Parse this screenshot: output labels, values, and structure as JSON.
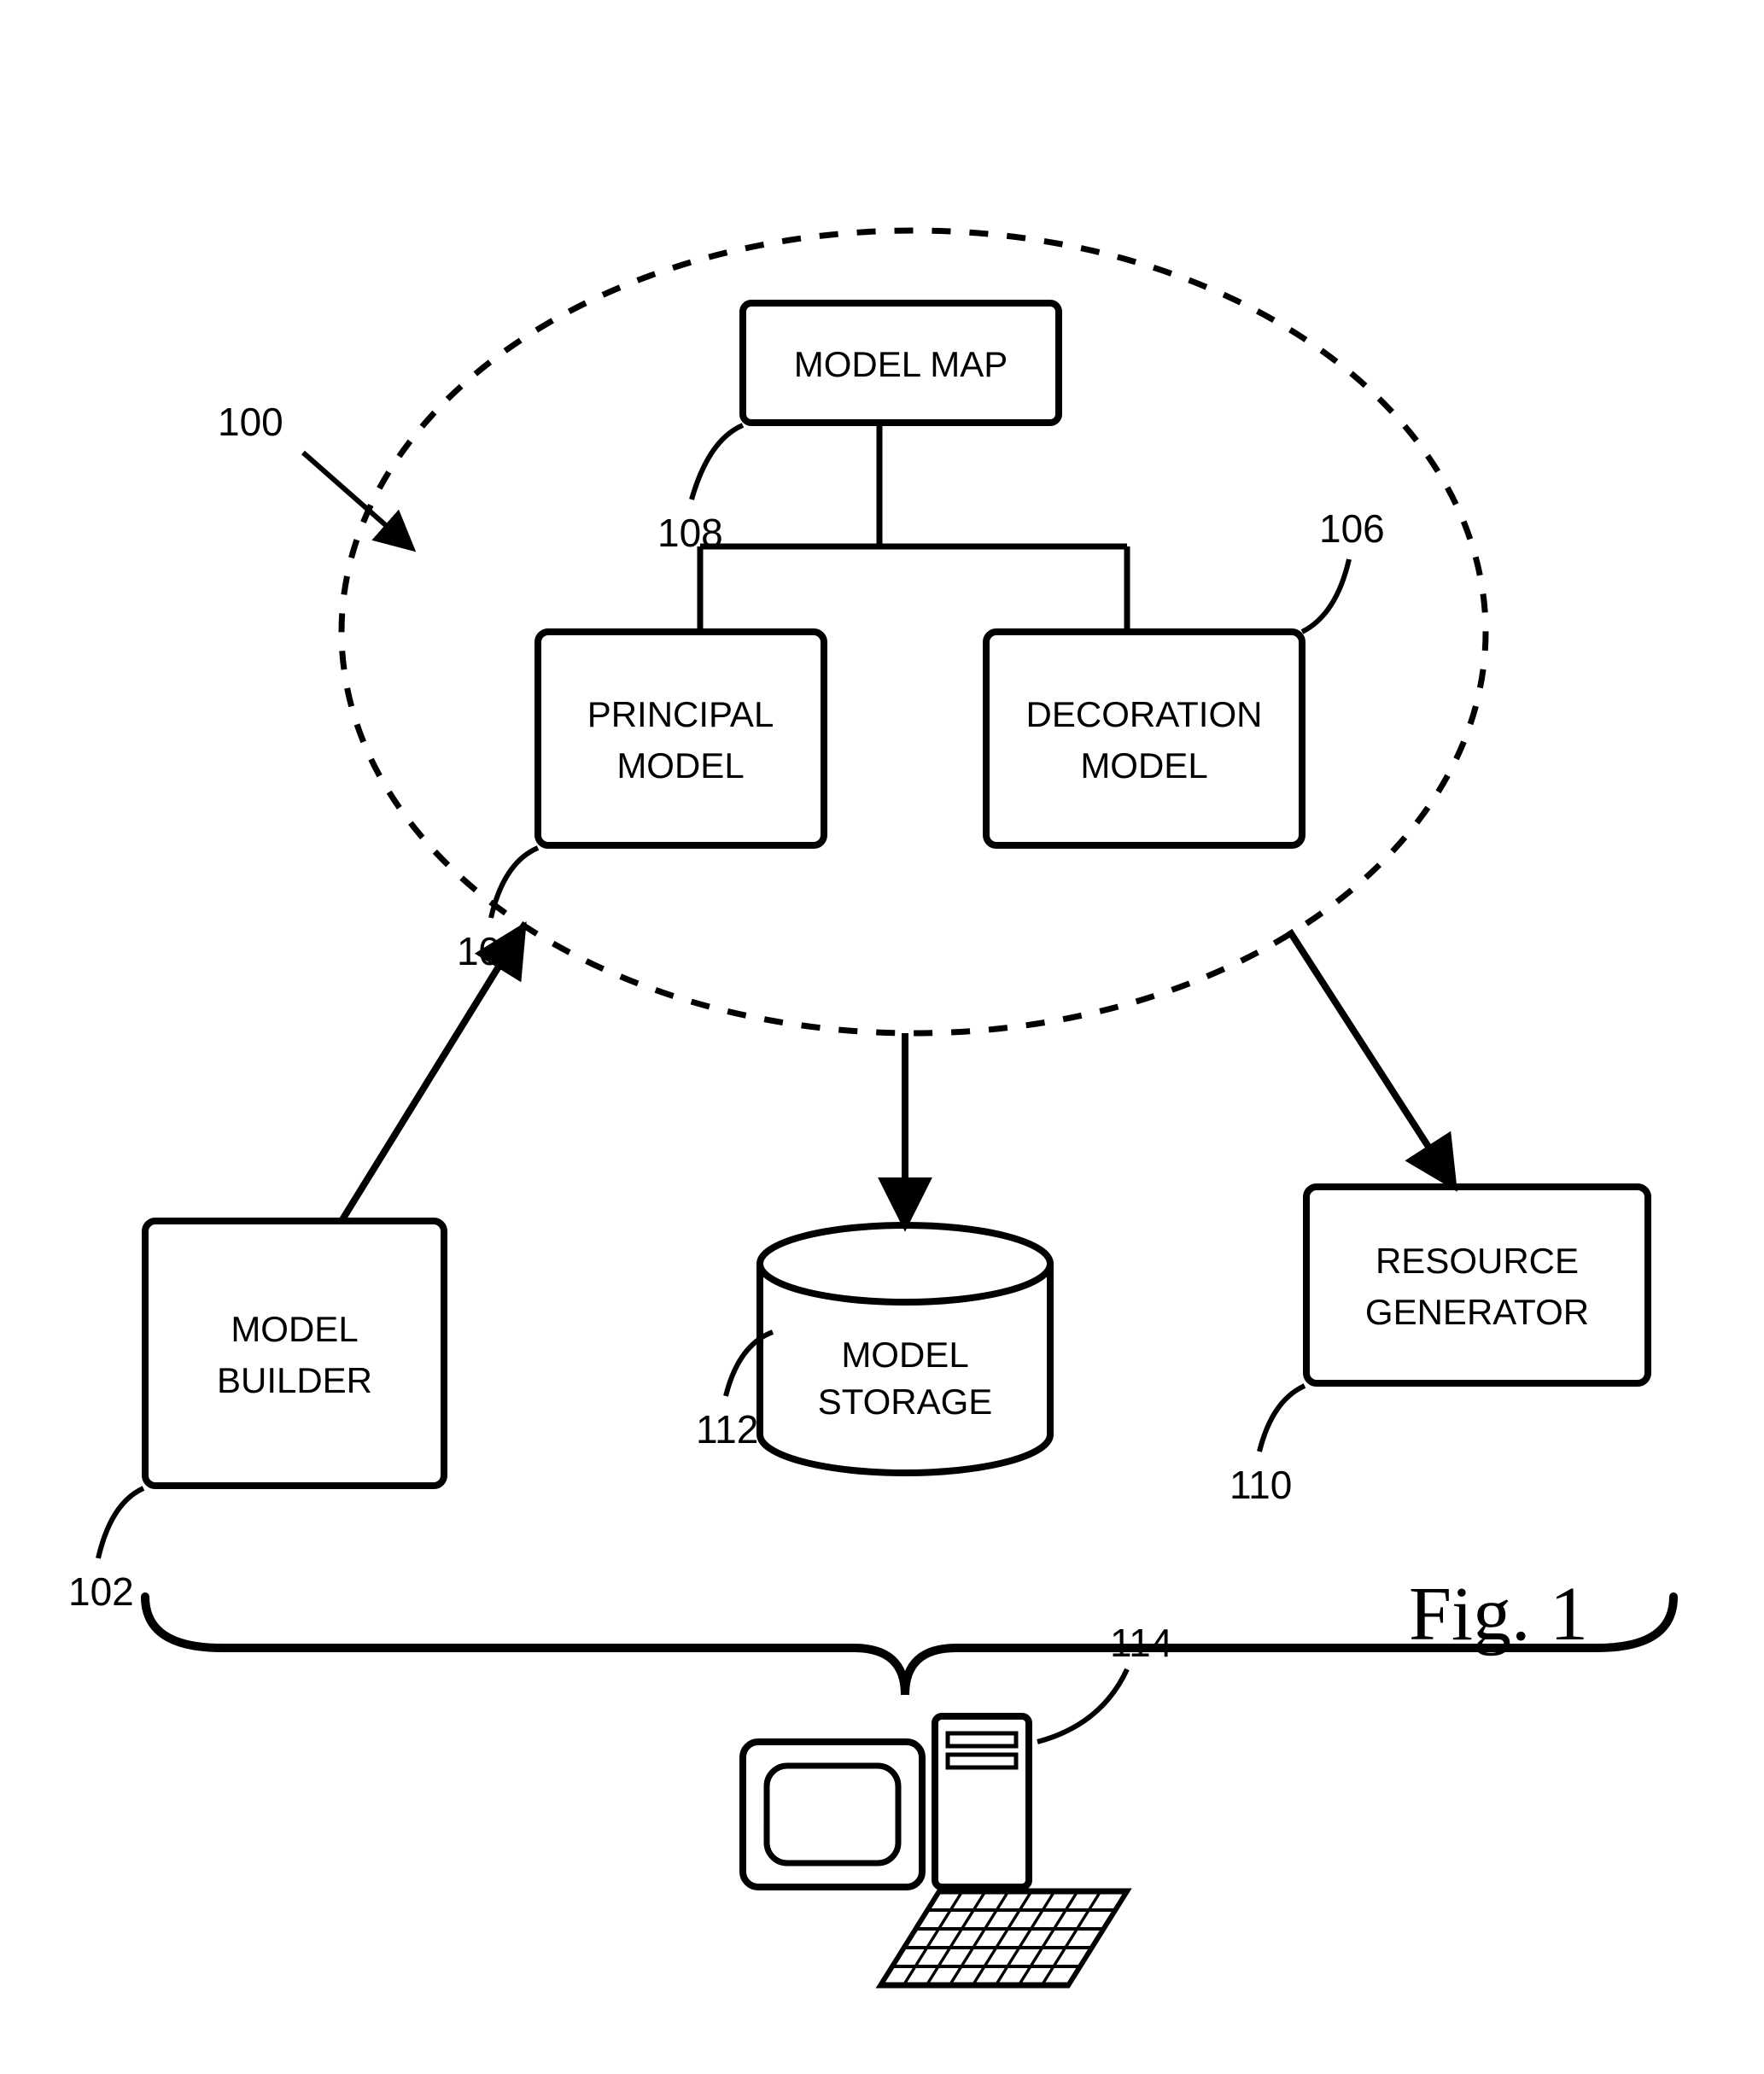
{
  "figure_label": "Fig. 1",
  "refs": {
    "r100": "100",
    "r102": "102",
    "r104": "104",
    "r106": "106",
    "r108": "108",
    "r110": "110",
    "r112": "112",
    "r114": "114"
  },
  "boxes": {
    "model_builder_l1": "MODEL",
    "model_builder_l2": "BUILDER",
    "principal_l1": "PRINCIPAL",
    "principal_l2": "MODEL",
    "decoration_l1": "DECORATION",
    "decoration_l2": "MODEL",
    "model_map": "MODEL MAP",
    "model_storage_l1": "MODEL",
    "model_storage_l2": "STORAGE",
    "resource_l1": "RESOURCE",
    "resource_l2": "GENERATOR"
  }
}
